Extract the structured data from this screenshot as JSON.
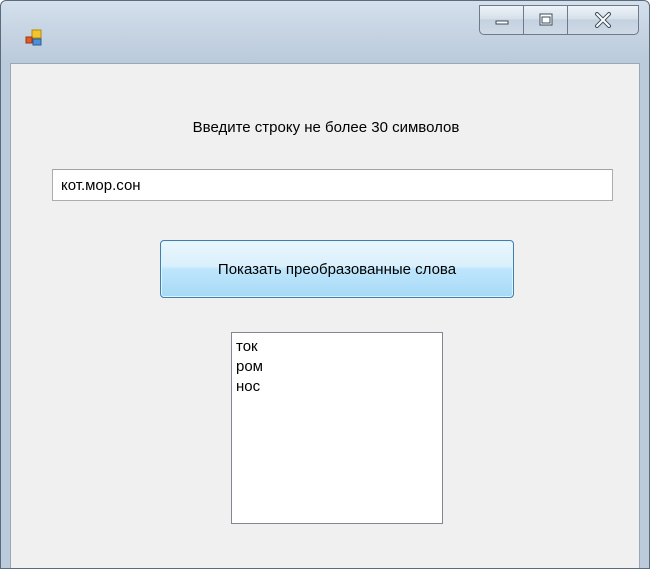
{
  "window": {
    "title": "",
    "icon": "windows-forms-app-icon",
    "controls": {
      "minimize_icon": "minimize-icon",
      "maximize_icon": "maximize-icon",
      "close_icon": "close-icon"
    }
  },
  "form": {
    "prompt": "Введите строку не более 30 символов",
    "input_value": "кот.мор.сон",
    "button_label": "Показать преобразованные слова",
    "results": [
      "ток",
      "ром",
      "нос"
    ]
  },
  "colors": {
    "client_background": "#f0f0f0",
    "button_border": "#3c7fb1",
    "titlebar": "#c6d4e3"
  }
}
